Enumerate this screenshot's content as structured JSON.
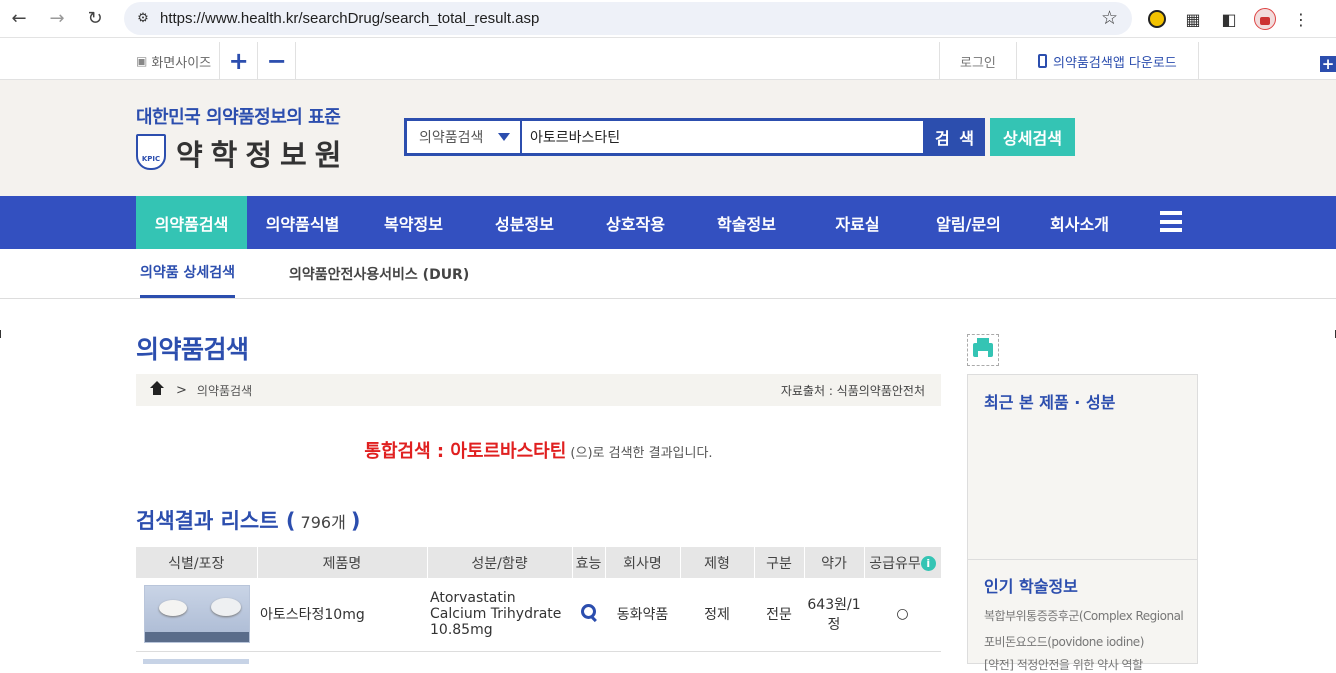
{
  "browser": {
    "url": "https://www.health.kr/searchDrug/search_total_result.asp"
  },
  "utility": {
    "screen_size_label": "화면사이즈",
    "zoom_in": "+",
    "zoom_out": "−",
    "login": "로그인",
    "app_download": "의약품검색앱 다운로드",
    "side_plus": "+"
  },
  "header": {
    "slogan": "대한민국 의약품정보의 표준",
    "logo_emblem": "KPIC",
    "logo_name": "약학정보원",
    "search_category": "의약품검색",
    "search_value": "아토르바스타틴",
    "search_button": "검 색",
    "detail_search_button": "상세검색"
  },
  "main_nav": [
    {
      "label": "의약품검색",
      "active": true
    },
    {
      "label": "의약품식별",
      "active": false
    },
    {
      "label": "복약정보",
      "active": false
    },
    {
      "label": "성분정보",
      "active": false
    },
    {
      "label": "상호작용",
      "active": false
    },
    {
      "label": "학술정보",
      "active": false
    },
    {
      "label": "자료실",
      "active": false
    },
    {
      "label": "알림/문의",
      "active": false
    },
    {
      "label": "회사소개",
      "active": false
    }
  ],
  "sub_nav": [
    {
      "label": "의약품 상세검색",
      "active": true
    },
    {
      "label": "의약품안전사용서비스 (DUR)",
      "active": false
    }
  ],
  "content": {
    "page_title": "의약품검색",
    "breadcrumb_current": "의약품검색",
    "breadcrumb_sep": ">",
    "source": "자료출처 : 식품의약품안전처",
    "result_prefix": "통합검색 : 아토르바스타틴",
    "result_suffix": " (으)로 검색한 결과입니다.",
    "list_title": "검색결과 리스트 (",
    "list_count": " 796개 ",
    "list_close": ")"
  },
  "table": {
    "headers": [
      "식별/포장",
      "제품명",
      "성분/함량",
      "효능",
      "회사명",
      "제형",
      "구분",
      "약가",
      "공급유무"
    ],
    "info_icon": "i",
    "rows": [
      {
        "product": "아토스타정10mg",
        "ingredient": "Atorvastatin Calcium Trihydrate 10.85mg",
        "company": "동화약품",
        "form": "정제",
        "category": "전문",
        "price": "643원/1정",
        "supply": "○"
      }
    ]
  },
  "sidebar": {
    "recent_title": "최근 본 제품 · 성분",
    "popular_title": "인기 학술정보",
    "popular_items": [
      "복합부위통증증후군(Complex Regional Pain Syndrome)",
      "포비돈요오드(povidone iodine)",
      "[약전] 적정안전을 위한 약사 역할"
    ]
  },
  "colors": {
    "brand_blue": "#3350c0",
    "accent_teal": "#34c4b4",
    "highlight_red": "#e02020"
  }
}
